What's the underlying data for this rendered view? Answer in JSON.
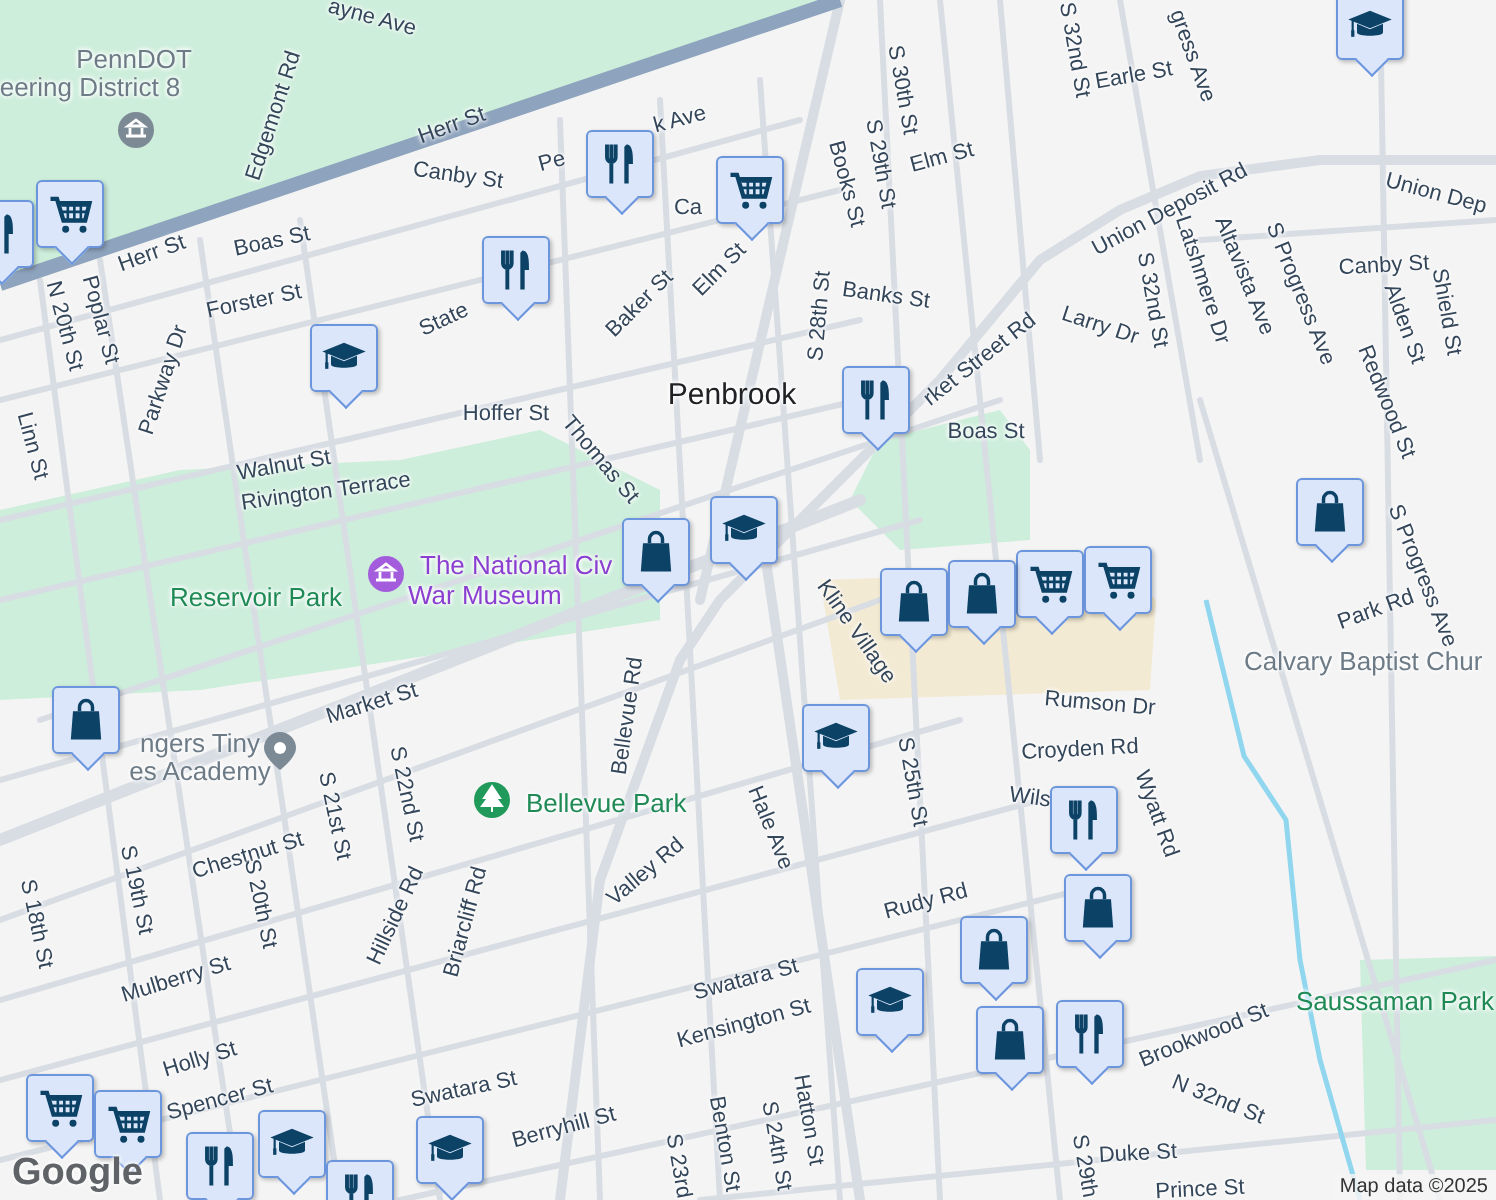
{
  "labels": [
    {
      "text": "ayne Ave",
      "kind": "street"
    },
    {
      "text": "PennDOT",
      "kind": "poi"
    },
    {
      "text": "eering District 8",
      "kind": "poi"
    },
    {
      "text": "Edgemont Rd",
      "kind": "street"
    },
    {
      "text": "Herr St",
      "kind": "street"
    },
    {
      "text": "Canby St",
      "kind": "street"
    },
    {
      "text": "Pe",
      "kind": "street"
    },
    {
      "text": "k Ave",
      "kind": "street"
    },
    {
      "text": "Ca",
      "kind": "street"
    },
    {
      "text": "S 30th St",
      "kind": "street"
    },
    {
      "text": "S 29th St",
      "kind": "street"
    },
    {
      "text": "Books St",
      "kind": "street"
    },
    {
      "text": "Elm St",
      "kind": "street"
    },
    {
      "text": "Herr St",
      "kind": "street"
    },
    {
      "text": "N 20th St",
      "kind": "street"
    },
    {
      "text": "Poplar St",
      "kind": "street"
    },
    {
      "text": "Boas St",
      "kind": "street"
    },
    {
      "text": "Elm St",
      "kind": "street"
    },
    {
      "text": "Baker St",
      "kind": "street"
    },
    {
      "text": "Banks St",
      "kind": "street"
    },
    {
      "text": "Forster St",
      "kind": "street"
    },
    {
      "text": "State",
      "kind": "street"
    },
    {
      "text": "S 28th St",
      "kind": "street"
    },
    {
      "text": "Parkway Dr",
      "kind": "street"
    },
    {
      "text": "Penbrook",
      "kind": "area"
    },
    {
      "text": "rket Street Rd",
      "kind": "street"
    },
    {
      "text": "Hoffer St",
      "kind": "street"
    },
    {
      "text": "Boas St",
      "kind": "street"
    },
    {
      "text": "Linn St",
      "kind": "street"
    },
    {
      "text": "Thomas St",
      "kind": "street"
    },
    {
      "text": "Walnut St",
      "kind": "street"
    },
    {
      "text": "Rivington Terrace",
      "kind": "street"
    },
    {
      "text": "The National Civ",
      "kind": "museum"
    },
    {
      "text": "War Museum",
      "kind": "museum"
    },
    {
      "text": "Reservoir Park",
      "kind": "park"
    },
    {
      "text": "Kline Village",
      "kind": "street"
    },
    {
      "text": "S 32nd St",
      "kind": "street"
    },
    {
      "text": "gress Ave",
      "kind": "street"
    },
    {
      "text": "Earle St",
      "kind": "street"
    },
    {
      "text": "Union Deposit Rd",
      "kind": "street"
    },
    {
      "text": "Union Dep",
      "kind": "street"
    },
    {
      "text": "S Progress Ave",
      "kind": "street"
    },
    {
      "text": "Canby St",
      "kind": "street"
    },
    {
      "text": "Larry Dr",
      "kind": "street"
    },
    {
      "text": "S 32nd St",
      "kind": "street"
    },
    {
      "text": "Latshmere Dr",
      "kind": "street"
    },
    {
      "text": "Altavista Ave",
      "kind": "street"
    },
    {
      "text": "Alden St",
      "kind": "street"
    },
    {
      "text": "Shield St",
      "kind": "street"
    },
    {
      "text": "Redwood St",
      "kind": "street"
    },
    {
      "text": "S Progress Ave",
      "kind": "street"
    },
    {
      "text": "Park Rd",
      "kind": "street"
    },
    {
      "text": "Calvary Baptist Chur",
      "kind": "poi"
    },
    {
      "text": "Market St",
      "kind": "street"
    },
    {
      "text": "ngers Tiny",
      "kind": "poi"
    },
    {
      "text": "es Academy",
      "kind": "poi"
    },
    {
      "text": "Bellevue Rd",
      "kind": "street"
    },
    {
      "text": "Rumson Dr",
      "kind": "street"
    },
    {
      "text": "Croyden Rd",
      "kind": "street"
    },
    {
      "text": "S 21st St",
      "kind": "street"
    },
    {
      "text": "S 22nd St",
      "kind": "street"
    },
    {
      "text": "Hale Ave",
      "kind": "street"
    },
    {
      "text": "S 25th St",
      "kind": "street"
    },
    {
      "text": "Wils",
      "kind": "street"
    },
    {
      "text": "Wyatt Rd",
      "kind": "street"
    },
    {
      "text": "Bellevue Park",
      "kind": "park"
    },
    {
      "text": "Chestnut St",
      "kind": "street"
    },
    {
      "text": "S 19th St",
      "kind": "street"
    },
    {
      "text": "S 20th St",
      "kind": "street"
    },
    {
      "text": "S 18th St",
      "kind": "street"
    },
    {
      "text": "Hillside Rd",
      "kind": "street"
    },
    {
      "text": "Briarcliff Rd",
      "kind": "street"
    },
    {
      "text": "Valley Rd",
      "kind": "street"
    },
    {
      "text": "Rudy Rd",
      "kind": "street"
    },
    {
      "text": "Mulberry St",
      "kind": "street"
    },
    {
      "text": "Swatara St",
      "kind": "street"
    },
    {
      "text": "Kensington St",
      "kind": "street"
    },
    {
      "text": "Holly St",
      "kind": "street"
    },
    {
      "text": "Swatara St",
      "kind": "street"
    },
    {
      "text": "Spencer St",
      "kind": "street"
    },
    {
      "text": "Berryhill St",
      "kind": "street"
    },
    {
      "text": "Saussaman Park",
      "kind": "park"
    },
    {
      "text": "Brookwood St",
      "kind": "street"
    },
    {
      "text": "N 32nd St",
      "kind": "street"
    },
    {
      "text": "Hatton St",
      "kind": "street"
    },
    {
      "text": "S 24th St",
      "kind": "street"
    },
    {
      "text": "S 23rd",
      "kind": "street"
    },
    {
      "text": "Benton St",
      "kind": "street"
    },
    {
      "text": "Duke St",
      "kind": "street"
    },
    {
      "text": "S 29th",
      "kind": "street"
    },
    {
      "text": "Prince St",
      "kind": "street"
    }
  ],
  "logo": "Google",
  "attribution": "Map data ©2025"
}
